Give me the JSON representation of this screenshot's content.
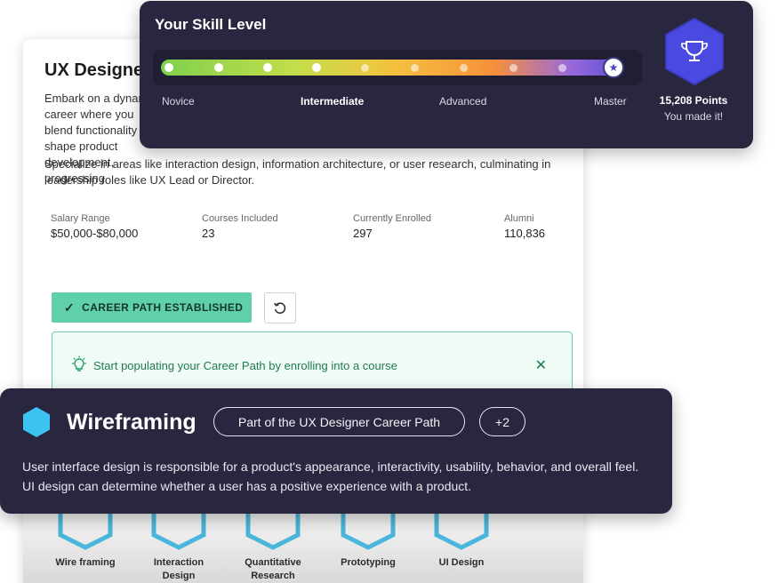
{
  "back_card": {
    "title": "UX Designer",
    "para1": "Embark on a dynamic career where you blend functionality to shape product development, progressing",
    "para2": "Specialize in areas like interaction design, information architecture, or user research, culminating in leadership roles like UX Lead or Director.",
    "stats": [
      {
        "label": "Salary Range",
        "value": "$50,000-$80,000"
      },
      {
        "label": "Courses Included",
        "value": "23"
      },
      {
        "label": "Currently Enrolled",
        "value": "297"
      },
      {
        "label": "Alumni",
        "value": "110,836"
      }
    ],
    "career_button": "CAREER PATH ESTABLISHED",
    "notice": "Start populating your Career Path by enrolling into a course",
    "courses": [
      "Wire framing",
      "Interaction Design",
      "Quantitative Research",
      "Prototyping",
      "UI Design"
    ]
  },
  "skill": {
    "title": "Your Skill Level",
    "levels": [
      "Novice",
      "Intermediate",
      "Advanced",
      "Master"
    ],
    "current_level": "Intermediate",
    "progress": 1.0,
    "points": "15,208 Points",
    "status": "You made it!"
  },
  "wireframing": {
    "title": "Wireframing",
    "tag": "Part of the UX Designer Career Path",
    "more": "+2",
    "description": "User interface design is responsible for a product's appearance, interactivity, usability, behavior, and overall feel. UI design can determine whether a user has a positive experience with a product."
  },
  "colors": {
    "card_dark": "#28273f",
    "accent_green": "#5fd0a9",
    "badge_blue": "#4a4ae0",
    "hex_cyan": "#3cc3f2"
  },
  "icons": [
    "check-icon",
    "reset-icon",
    "lightbulb-icon",
    "close-icon",
    "star-icon",
    "trophy-icon",
    "hexagon-icon"
  ]
}
